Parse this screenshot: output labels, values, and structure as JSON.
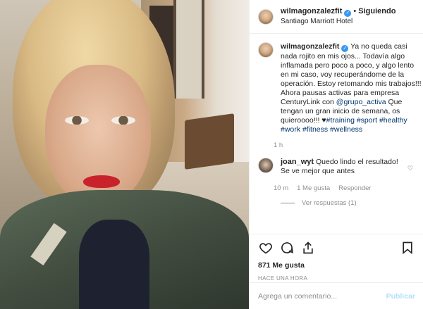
{
  "post": {
    "author": "wilmagonzalezfit",
    "follow_status": "Siguiendo",
    "location": "Santiago Marriott Hotel",
    "caption": {
      "username": "wilmagonzalezfit",
      "text_1": "Ya no queda casi nada rojito en mis ojos... Todavía algo inflamada pero poco a poco, y algo lento en mi caso, voy recuperándome de la operación. Estoy retomando mis trabajos!!! Ahora pausas activas para empresa CenturyLink con ",
      "mention": "@grupo_activa",
      "text_2": " Que tengan un gran inicio de semana, os quieroooo!!! ♥",
      "hashtags": [
        "#training",
        "#sport",
        "#healthy",
        "#work",
        "#fitness",
        "#wellness"
      ],
      "age": "1 h"
    },
    "comment": {
      "username": "joan_wyt",
      "text": "Quedo lindo el resultado! Se ve mejor que antes",
      "age": "10 m",
      "likes": "1 Me gusta",
      "reply": "Responder",
      "view_replies": "Ver respuestas (1)"
    },
    "likes": "871 Me gusta",
    "timestamp": "HACE UNA HORA",
    "add_comment_placeholder": "Agrega un comentario...",
    "publish_label": "Publicar"
  },
  "icons": {
    "like": "heart-icon",
    "comment": "comment-icon",
    "share": "share-icon",
    "save": "bookmark-icon",
    "verified": "verified-badge-icon"
  },
  "colors": {
    "link": "#003569",
    "muted": "#8e8e8e",
    "verified": "#3897f0",
    "publish_disabled": "#b2dffc"
  }
}
